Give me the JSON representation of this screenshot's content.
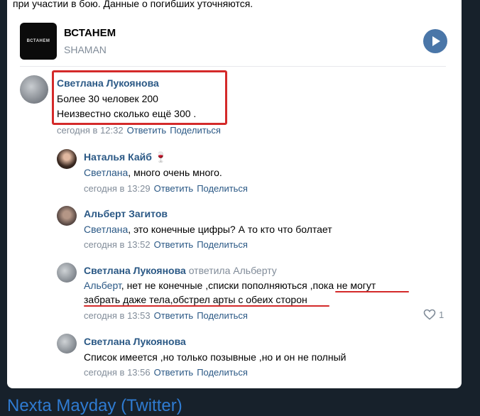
{
  "post": {
    "text_tail": "при участии в бою. Данные о погибших уточняются."
  },
  "music": {
    "cover_label": "ВСТАНЕМ",
    "title": "ВСТАНЕМ",
    "artist": "SHAMAN"
  },
  "comments": [
    {
      "author": "Светлана Лукоянова",
      "lines": [
        "Более 30 человек 200",
        "Неизвестно сколько ещё 300 ."
      ],
      "time": "сегодня в 12:32",
      "reply": "Ответить",
      "share": "Поделиться"
    }
  ],
  "replies": [
    {
      "author": "Наталья Кайб",
      "author_emoji": "🍷",
      "mention": "Светлана",
      "text": ", много очень много.",
      "time": "сегодня в 13:29",
      "reply": "Ответить",
      "share": "Поделиться"
    },
    {
      "author": "Альберт Загитов",
      "mention": "Светлана",
      "text": ", это конечные цифры? А то кто что болтает",
      "time": "сегодня в 13:52",
      "reply": "Ответить",
      "share": "Поделиться"
    },
    {
      "author": "Светлана Лукоянова",
      "replied_to": "ответила Альберту",
      "mention": "Альберт",
      "text_line1": ", нет не конечные ,списки пополняються ,пока не могут",
      "text_line2": "забрать даже тела,обстрел арты с обеих сторон",
      "time": "сегодня в 13:53",
      "reply": "Ответить",
      "share": "Поделиться",
      "likes": "1"
    },
    {
      "author": "Светлана Лукоянова",
      "text": "Список имеется ,но только позывные ,но и он не полный",
      "time": "сегодня в 13:56",
      "reply": "Ответить",
      "share": "Поделиться"
    }
  ],
  "footer": {
    "link_text": "Nexta Mayday (Twitter)"
  },
  "colors": {
    "background": "#17212b",
    "link": "#2a5885",
    "muted": "#818c99",
    "annotation": "#d42a2a",
    "play_button": "#4a76a8"
  }
}
